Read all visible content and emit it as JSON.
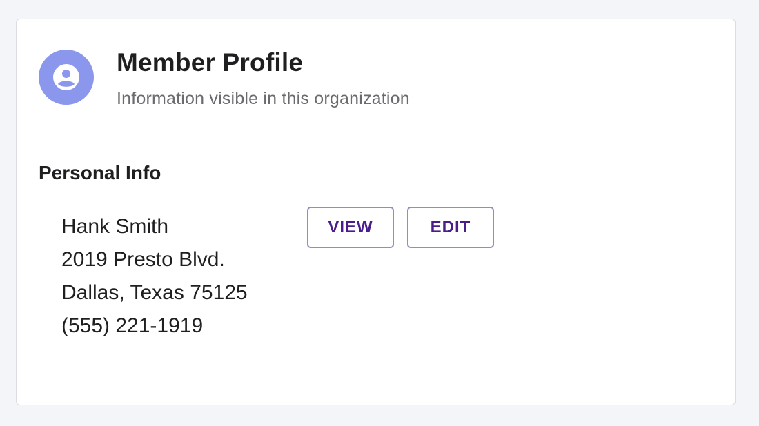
{
  "header": {
    "title": "Member Profile",
    "subtitle": "Information visible in this organization",
    "avatar_icon": "account-circle-icon",
    "avatar_color": "#8b97ec"
  },
  "section": {
    "heading": "Personal Info",
    "address_lines": [
      "Hank Smith",
      "2019 Presto Blvd.",
      "Dallas, Texas 75125",
      "(555) 221-1919"
    ]
  },
  "actions": {
    "view_label": "VIEW",
    "edit_label": "EDIT",
    "accent_color": "#4b1c8c"
  }
}
